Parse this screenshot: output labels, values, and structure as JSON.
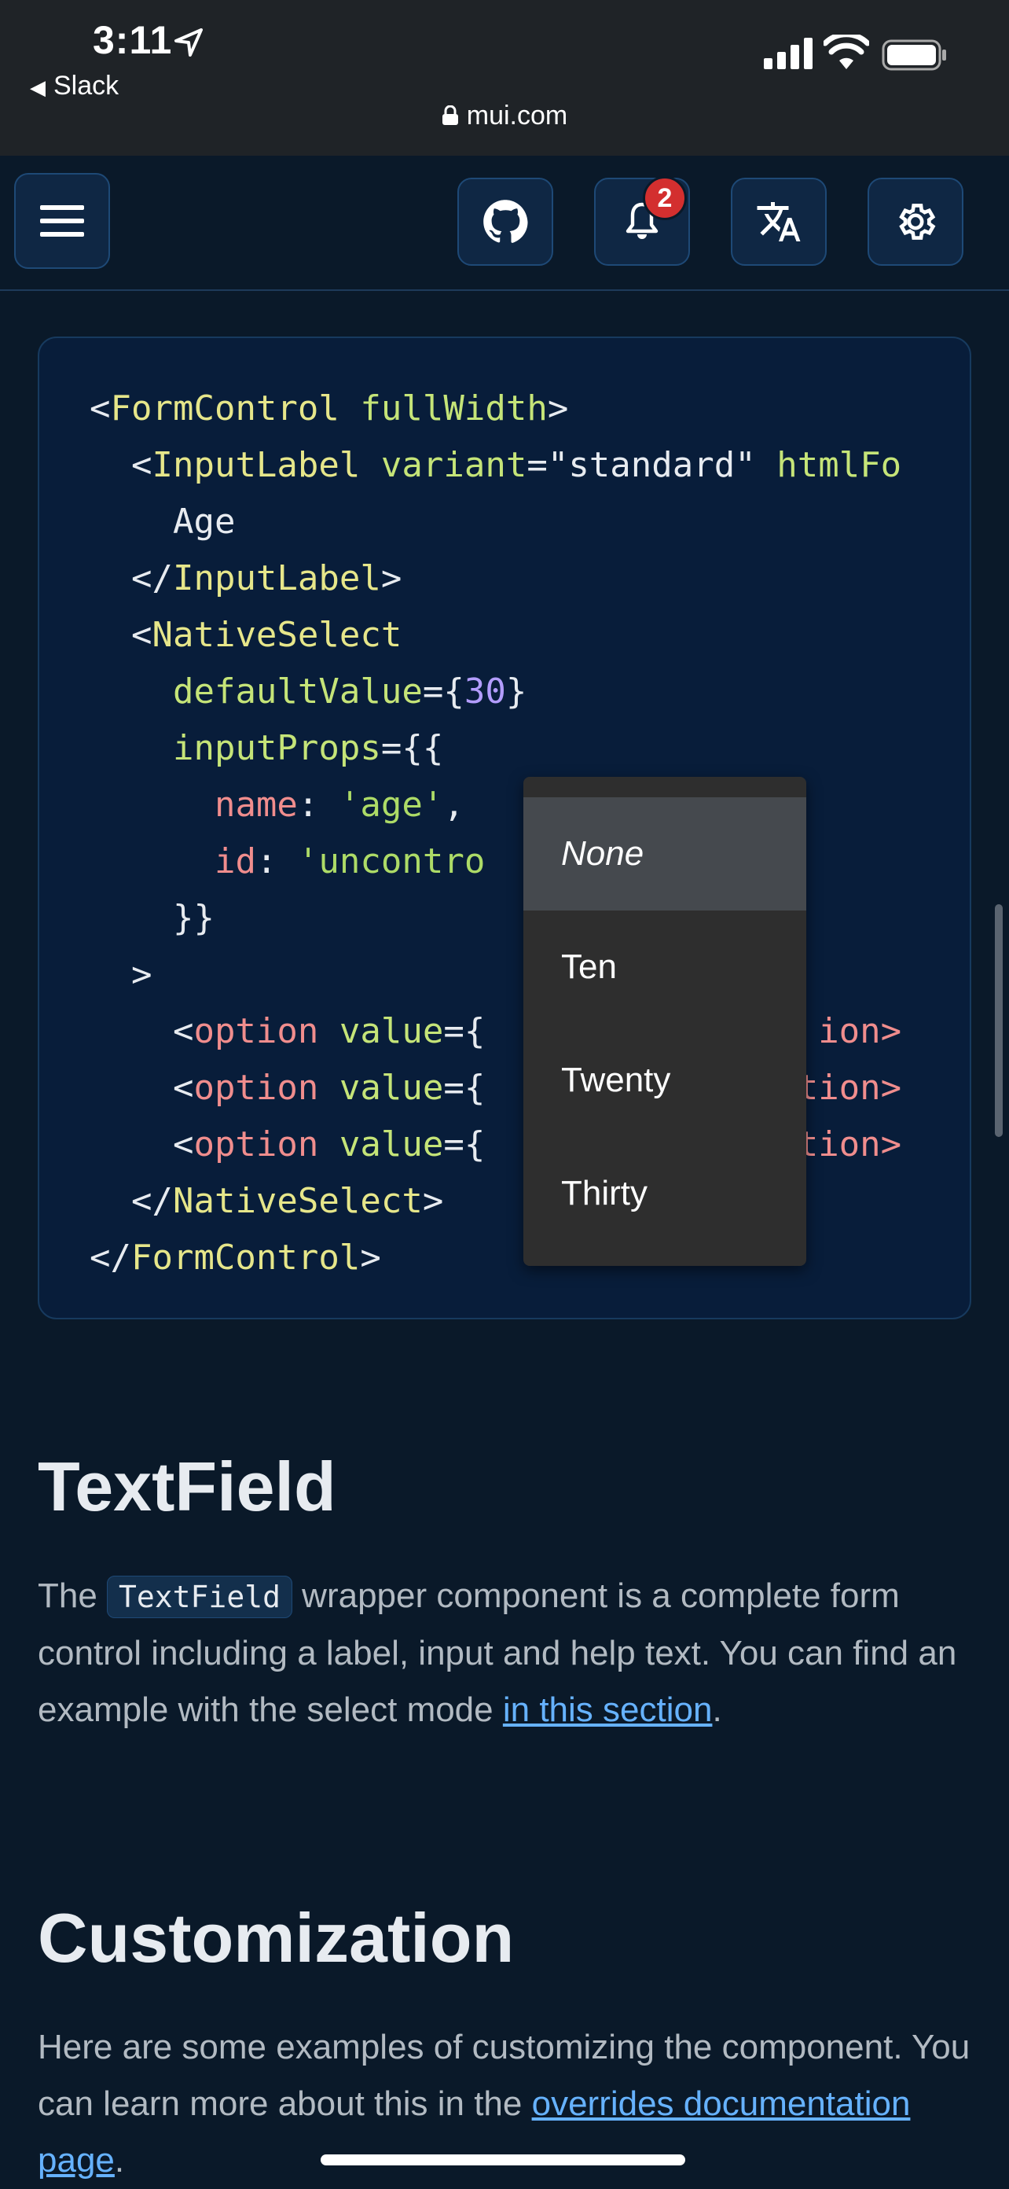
{
  "status": {
    "time": "3:11",
    "back_app": "Slack",
    "url": "mui.com"
  },
  "appbar": {
    "notifications_count": "2"
  },
  "code": {
    "lines": [
      "<FormControl fullWidth>",
      "  <InputLabel variant=\"standard\" htmlFo",
      "    Age",
      "  </InputLabel>",
      "  <NativeSelect",
      "    defaultValue={30}",
      "    inputProps={{",
      "      name: 'age',",
      "      id: 'uncontro",
      "    }}",
      "  >",
      "    <option value={",
      "    <option value={",
      "    <option value={",
      "  </NativeSelect>",
      "</FormControl>"
    ],
    "tails": [
      "ion>",
      "option>",
      "option>"
    ]
  },
  "dropdown": {
    "options": [
      "None",
      "Ten",
      "Twenty",
      "Thirty"
    ],
    "selected": "None"
  },
  "textfield": {
    "heading": "TextField",
    "p_before": "The ",
    "p_code": "TextField",
    "p_after": " wrapper component is a complete form control including a label, input and help text. You can find an example with the select mode ",
    "link": "in this section",
    "p_end": "."
  },
  "customization": {
    "heading": "Customization",
    "p_text": "Here are some examples of customizing the component. You can learn more about this in the ",
    "link": "overrides documentation page",
    "p_end": "."
  }
}
